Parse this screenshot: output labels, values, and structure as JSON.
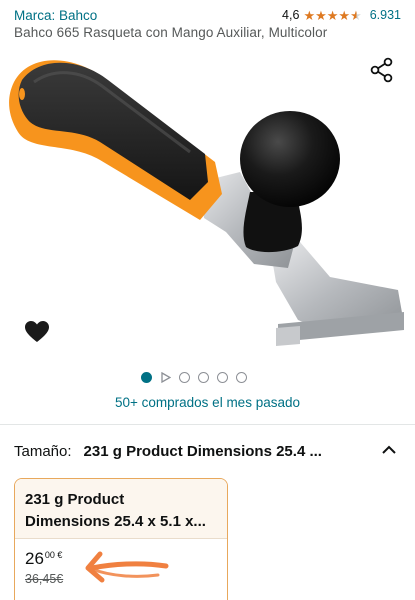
{
  "header": {
    "brand": "Marca: Bahco",
    "rating": "4,6",
    "rating_stars": 4.6,
    "review_count": "6.931",
    "title": "Bahco 665 Rasqueta con Mango Auxiliar, Multicolor"
  },
  "gallery": {
    "image_count": 6,
    "active_index": 0,
    "video_index": 1
  },
  "social_proof": {
    "bought_text": "50+ comprados el mes pasado"
  },
  "size_selector": {
    "label": "Tamaño:",
    "selected_value": "231 g Product Dimensions 25.4 ...",
    "options": [
      {
        "name_line1": "231 g Product",
        "name_line2": "Dimensions 25.4 x 5.1 x...",
        "price_whole": "26",
        "price_fraction": "00 €",
        "price_old": "36,45€"
      }
    ]
  },
  "colors": {
    "link": "#007185",
    "star": "#de7921",
    "selected_border": "#e8a85c",
    "annotation": "#f08040",
    "handle_orange": "#f7941d"
  }
}
